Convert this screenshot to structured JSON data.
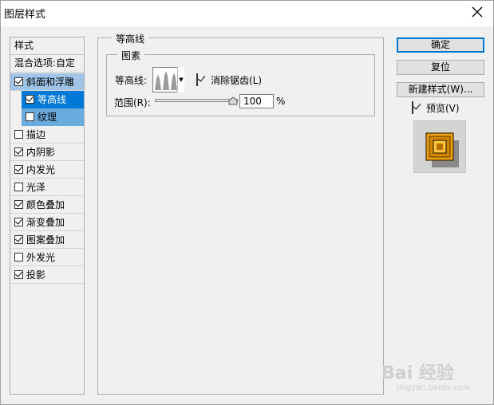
{
  "window": {
    "title": "图层样式"
  },
  "styles": {
    "header": "样式",
    "blend_options": "混合选项:自定",
    "items": [
      {
        "label": "斜面和浮雕",
        "checked": true
      },
      {
        "label": "等高线",
        "checked": true
      },
      {
        "label": "纹理",
        "checked": false
      },
      {
        "label": "描边",
        "checked": false
      },
      {
        "label": "内阴影",
        "checked": true
      },
      {
        "label": "内发光",
        "checked": true
      },
      {
        "label": "光泽",
        "checked": false
      },
      {
        "label": "颜色叠加",
        "checked": true
      },
      {
        "label": "渐变叠加",
        "checked": true
      },
      {
        "label": "图案叠加",
        "checked": true
      },
      {
        "label": "外发光",
        "checked": false
      },
      {
        "label": "投影",
        "checked": true
      }
    ]
  },
  "main": {
    "group_title": "等高线",
    "subgroup_title": "图素",
    "contour_label": "等高线:",
    "antialias_label": "消除锯齿(L)",
    "antialias_checked": true,
    "range_label": "范围(R):",
    "range_value": "100",
    "range_unit": "%"
  },
  "buttons": {
    "ok": "确定",
    "reset": "复位",
    "new_style": "新建样式(W)...",
    "preview_label": "预览(V)",
    "preview_checked": true
  },
  "watermark": {
    "text": "Bai 经验",
    "url": "jingyan.baidu.com"
  },
  "colors": {
    "selected": "#0078d7",
    "parent_selected": "#9fc4e8",
    "sub_selected": "#6aabde"
  }
}
